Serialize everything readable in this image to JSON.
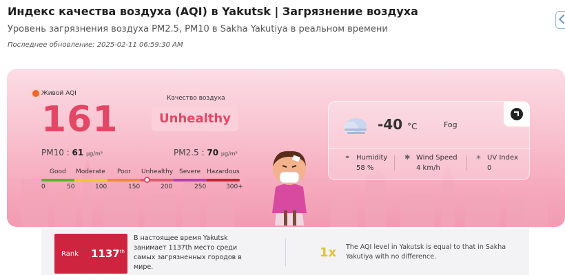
{
  "header": {
    "title": "Индекс качества воздуха (AQI) в Yakutsk | Загрязнение воздуха",
    "subtitle": "Уровень загрязнения воздуха PM2.5, PM10 в Sakha Yakutiya в реальном времени",
    "last_updated": "Последнее обновление: 2025-02-11 06:59:30 AM"
  },
  "aqi": {
    "live_label": "Живой AQI",
    "value": "161",
    "quality_label": "Качество воздуха",
    "quality_value": "Unhealthy",
    "pm10_label": "PM10 :",
    "pm10_value": "61",
    "pm25_label": "PM2.5 :",
    "pm25_value": "70",
    "unit": "µg/m³",
    "scale": {
      "categories": [
        "Good",
        "Moderate",
        "Poor",
        "Unhealthy",
        "Severe",
        "Hazardous"
      ],
      "ticks": [
        "0",
        "50",
        "100",
        "150",
        "200",
        "250",
        "300+"
      ],
      "colors": [
        "#59b61f",
        "#eec732",
        "#ea8c34",
        "#e9556f",
        "#b33fba",
        "#c92033"
      ],
      "current_value": 161
    }
  },
  "weather": {
    "temperature": "-40",
    "temp_unit": "°C",
    "condition": "Fog",
    "humidity_label": "Humidity",
    "humidity_value": "58 %",
    "wind_label": "Wind Speed",
    "wind_value": "4 km/h",
    "uv_label": "UV Index",
    "uv_value": "0",
    "icons": [
      "fog-cloud-icon",
      "humidity-icon",
      "wind-icon",
      "uv-icon",
      "expand-arrow-icon"
    ]
  },
  "ranking": {
    "rank_label": "Rank",
    "rank_value": "1137",
    "rank_suffix": "th",
    "rank_text": "В настоящее время Yakutsk занимает 1137th место среди самых загрязненных городов в мире.",
    "multiplier": "1x",
    "compare_text": "The AQI level in Yakutsk is equal to that in Sakha Yakutiya with no difference."
  },
  "colors": {
    "accent": "#e34766",
    "rank_badge": "#cf2440",
    "multiplier": "#e6c031"
  }
}
